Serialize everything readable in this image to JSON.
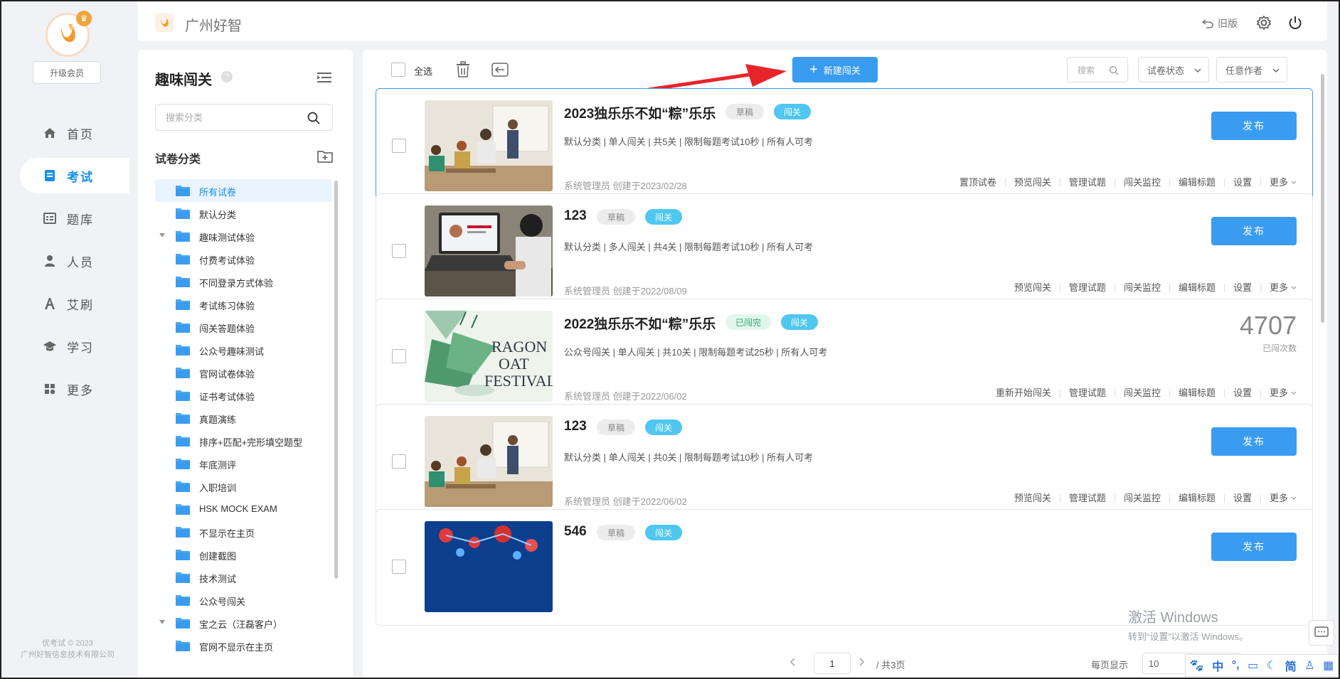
{
  "sidebar": {
    "upgrade_label": "升级会员",
    "nav": [
      {
        "label": "首页",
        "icon": "home-icon"
      },
      {
        "label": "考试",
        "icon": "exam-icon"
      },
      {
        "label": "题库",
        "icon": "question-bank-icon"
      },
      {
        "label": "人员",
        "icon": "user-icon"
      },
      {
        "label": "艾刷",
        "icon": "font-icon"
      },
      {
        "label": "学习",
        "icon": "graduation-cap-icon"
      },
      {
        "label": "更多",
        "icon": "grid-icon"
      }
    ],
    "active_index": 1,
    "copyright_line1": "优考试 © 2023",
    "copyright_line2": "广州好智信息技术有限公司"
  },
  "header": {
    "title": "广州好智",
    "old_version_label": "旧版"
  },
  "categories": {
    "title": "趣味闯关",
    "help": "?",
    "search_placeholder": "搜索分类",
    "subtitle": "试卷分类",
    "items": [
      {
        "label": "所有试卷",
        "selected": true,
        "expandable": false
      },
      {
        "label": "默认分类",
        "selected": false,
        "expandable": false
      },
      {
        "label": "趣味测试体验",
        "selected": false,
        "expandable": true
      },
      {
        "label": "付费考试体验",
        "selected": false,
        "expandable": false
      },
      {
        "label": "不同登录方式体验",
        "selected": false,
        "expandable": false
      },
      {
        "label": "考试练习体验",
        "selected": false,
        "expandable": false
      },
      {
        "label": "闯关答题体验",
        "selected": false,
        "expandable": false
      },
      {
        "label": "公众号趣味测试",
        "selected": false,
        "expandable": false
      },
      {
        "label": "官网试卷体验",
        "selected": false,
        "expandable": false
      },
      {
        "label": "证书考试体验",
        "selected": false,
        "expandable": false
      },
      {
        "label": "真题演练",
        "selected": false,
        "expandable": false
      },
      {
        "label": "排序+匹配+完形填空题型",
        "selected": false,
        "expandable": false
      },
      {
        "label": "年底测评",
        "selected": false,
        "expandable": false
      },
      {
        "label": "入职培训",
        "selected": false,
        "expandable": false
      },
      {
        "label": "HSK MOCK EXAM",
        "selected": false,
        "expandable": false
      },
      {
        "label": "不显示在主页",
        "selected": false,
        "expandable": false
      },
      {
        "label": "创建截图",
        "selected": false,
        "expandable": false
      },
      {
        "label": "技术测试",
        "selected": false,
        "expandable": false
      },
      {
        "label": "公众号闯关",
        "selected": false,
        "expandable": false
      },
      {
        "label": "宝之云（汪磊客户）",
        "selected": false,
        "expandable": true
      },
      {
        "label": "官网不显示在主页",
        "selected": false,
        "expandable": false
      }
    ]
  },
  "toolbar": {
    "select_all": "全选",
    "new_button": "新建闯关",
    "search_placeholder": "搜索",
    "status_select": "试卷状态",
    "author_select": "任意作者"
  },
  "cards": [
    {
      "title": "2023独乐乐不如“粽”乐乐",
      "status": "草稿",
      "status_kind": "gray",
      "type": "闯关",
      "meta": "默认分类 | 单人闯关 | 共5关 | 限制每题考试10秒 | 所有人可考",
      "author": "系统管理员 创建于2023/02/28",
      "actions": [
        "置顶试卷",
        "预览闯关",
        "管理试题",
        "闯关监控",
        "编辑标题",
        "设置"
      ],
      "more": "更多",
      "publish": "发布",
      "thumb": "classroom"
    },
    {
      "title": "123",
      "status": "草稿",
      "status_kind": "gray",
      "type": "闯关",
      "meta": "默认分类 | 多人闯关 | 共4关 | 限制每题考试10秒 | 所有人可考",
      "author": "系统管理员 创建于2022/08/09",
      "actions": [
        "预览闯关",
        "管理试题",
        "闯关监控",
        "编辑标题",
        "设置"
      ],
      "more": "更多",
      "publish": "发布",
      "thumb": "laptop"
    },
    {
      "title": "2022独乐乐不如“粽”乐乐",
      "status": "已闯完",
      "status_kind": "green",
      "type": "闯关",
      "meta": "公众号闯关 | 单人闯关 | 共10关 | 限制每题考试25秒 | 所有人可考",
      "author": "系统管理员 创建于2022/06/02",
      "actions": [
        "重新开始闯关",
        "管理试题",
        "闯关监控",
        "编辑标题",
        "设置"
      ],
      "more": "更多",
      "count": "4707",
      "count_label": "已闯次数",
      "thumb": "festival",
      "thumb_text": "RAGON",
      "thumb_text2": "OAT",
      "thumb_text3": "FESTIVAL"
    },
    {
      "title": "123",
      "status": "草稿",
      "status_kind": "gray",
      "type": "闯关",
      "meta": "默认分类 | 单人闯关 | 共0关 | 限制每题考试10秒 | 所有人可考",
      "author": "系统管理员 创建于2022/06/02",
      "actions": [
        "预览闯关",
        "管理试题",
        "闯关监控",
        "编辑标题",
        "设置"
      ],
      "more": "更多",
      "publish": "发布",
      "thumb": "classroom"
    },
    {
      "title": "546",
      "status": "草稿",
      "status_kind": "gray",
      "type": "闯关",
      "meta": "",
      "author": "",
      "actions": [],
      "more": "",
      "publish": "发布",
      "thumb": "molecule"
    }
  ],
  "pager": {
    "page": "1",
    "total": "/ 共3页",
    "per_page_label": "每页显示",
    "per_page": "10"
  },
  "watermark": {
    "line1": "激活 Windows",
    "line2": "转到“设置”以激活 Windows。"
  },
  "ime": [
    "中",
    "°,",
    "简"
  ],
  "colors": {
    "accent": "#3a9cf0",
    "badge_blue": "#4fc7f0",
    "badge_green_text": "#2eaa6e",
    "arrow_red": "#e8242b"
  }
}
